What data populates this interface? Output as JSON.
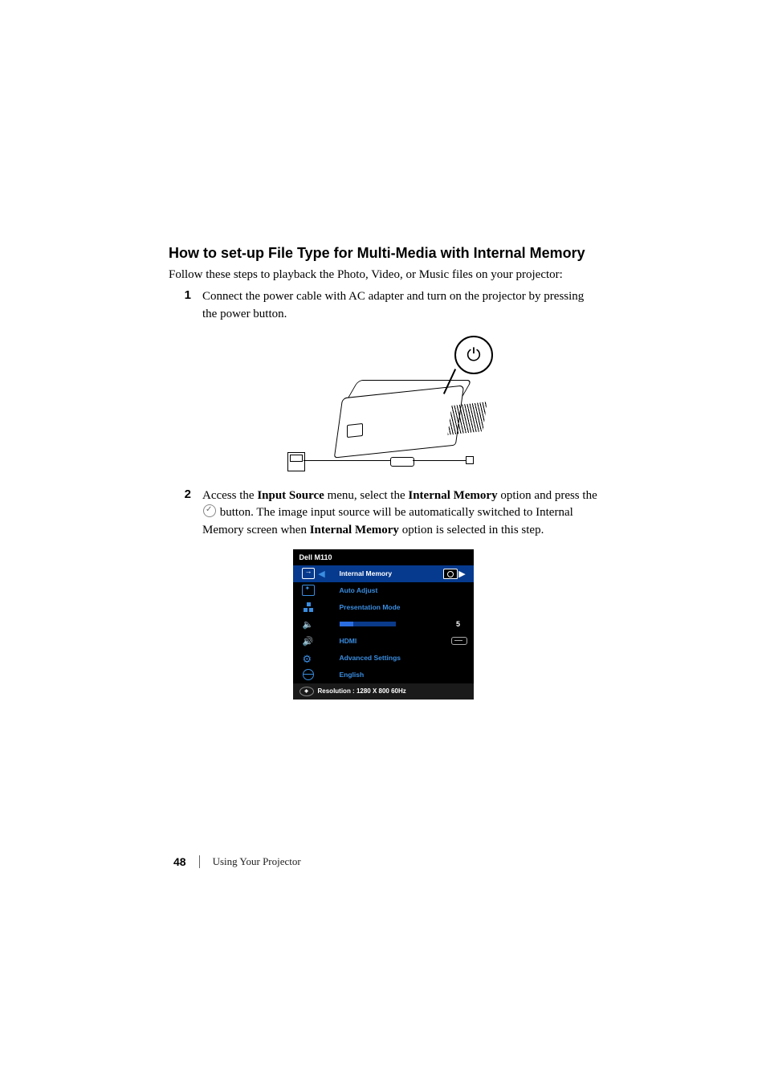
{
  "heading": "How to set-up File Type for Multi-Media with Internal Memory",
  "intro": "Follow these steps to playback the Photo, Video, or Music files on your projector:",
  "steps": [
    {
      "num": "1",
      "parts": [
        {
          "type": "text",
          "value": "Connect the power cable with AC adapter and turn on the projector by pressing the power button."
        }
      ]
    },
    {
      "num": "2",
      "parts": [
        {
          "type": "text",
          "value": "Access the "
        },
        {
          "type": "bold",
          "value": "Input Source"
        },
        {
          "type": "text",
          "value": " menu, select the "
        },
        {
          "type": "bold",
          "value": "Internal Memory"
        },
        {
          "type": "text",
          "value": " option and press the "
        },
        {
          "type": "checkbtn"
        },
        {
          "type": "text",
          "value": " button. The image input source will be automatically switched to Internal Memory screen when "
        },
        {
          "type": "bold",
          "value": "Internal Memory"
        },
        {
          "type": "text",
          "value": " option is selected in this step."
        }
      ]
    }
  ],
  "power_glyph": "⏻",
  "osd": {
    "title": "Dell  M110",
    "rows": [
      {
        "icon": "input",
        "label": "Internal Memory",
        "selected": true,
        "right_widget": "camera",
        "show_arrows": true
      },
      {
        "icon": "adjust",
        "label": "Auto Adjust"
      },
      {
        "icon": "mode",
        "label": "Presentation Mode"
      },
      {
        "icon": "vol",
        "slider": true,
        "value": "5"
      },
      {
        "icon": "volp",
        "label": "HDMI",
        "right_widget": "hdmi"
      },
      {
        "icon": "gear",
        "label": "Advanced Settings"
      },
      {
        "icon": "globe",
        "label": "English"
      }
    ],
    "footer": "Resolution : 1280 X 800 60Hz"
  },
  "footer": {
    "page": "48",
    "section": "Using Your Projector"
  }
}
